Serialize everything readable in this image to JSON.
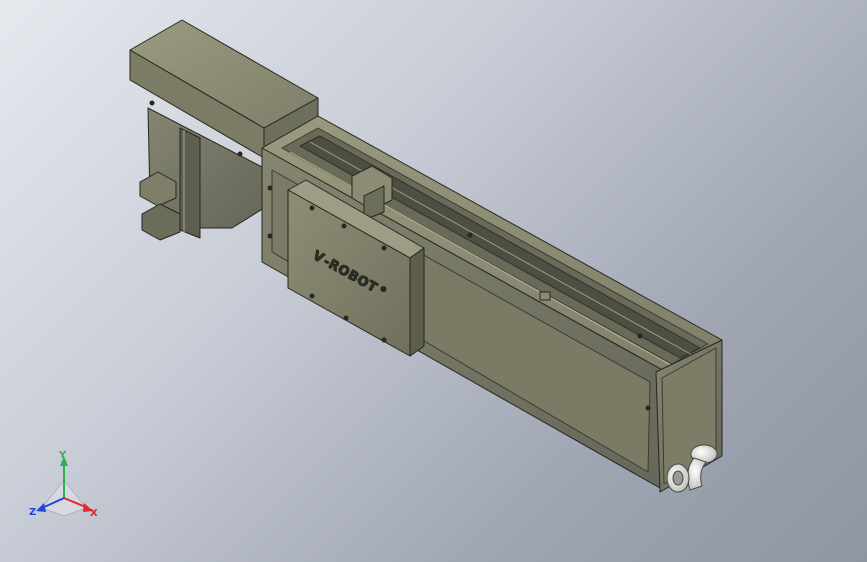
{
  "brand": {
    "mark": "V",
    "name": "-ROBOT",
    "reg": "®"
  },
  "triad": {
    "x_label": "X",
    "y_label": "Y",
    "z_label": "Z",
    "x_color": "#e0262a",
    "y_color": "#2bb24c",
    "z_color": "#2646d6"
  },
  "colors": {
    "body_top": "#8b8b73",
    "body_side": "#767662",
    "body_dark": "#5a5a4a",
    "edge": "#26271f",
    "hose": "#dcdcda"
  }
}
